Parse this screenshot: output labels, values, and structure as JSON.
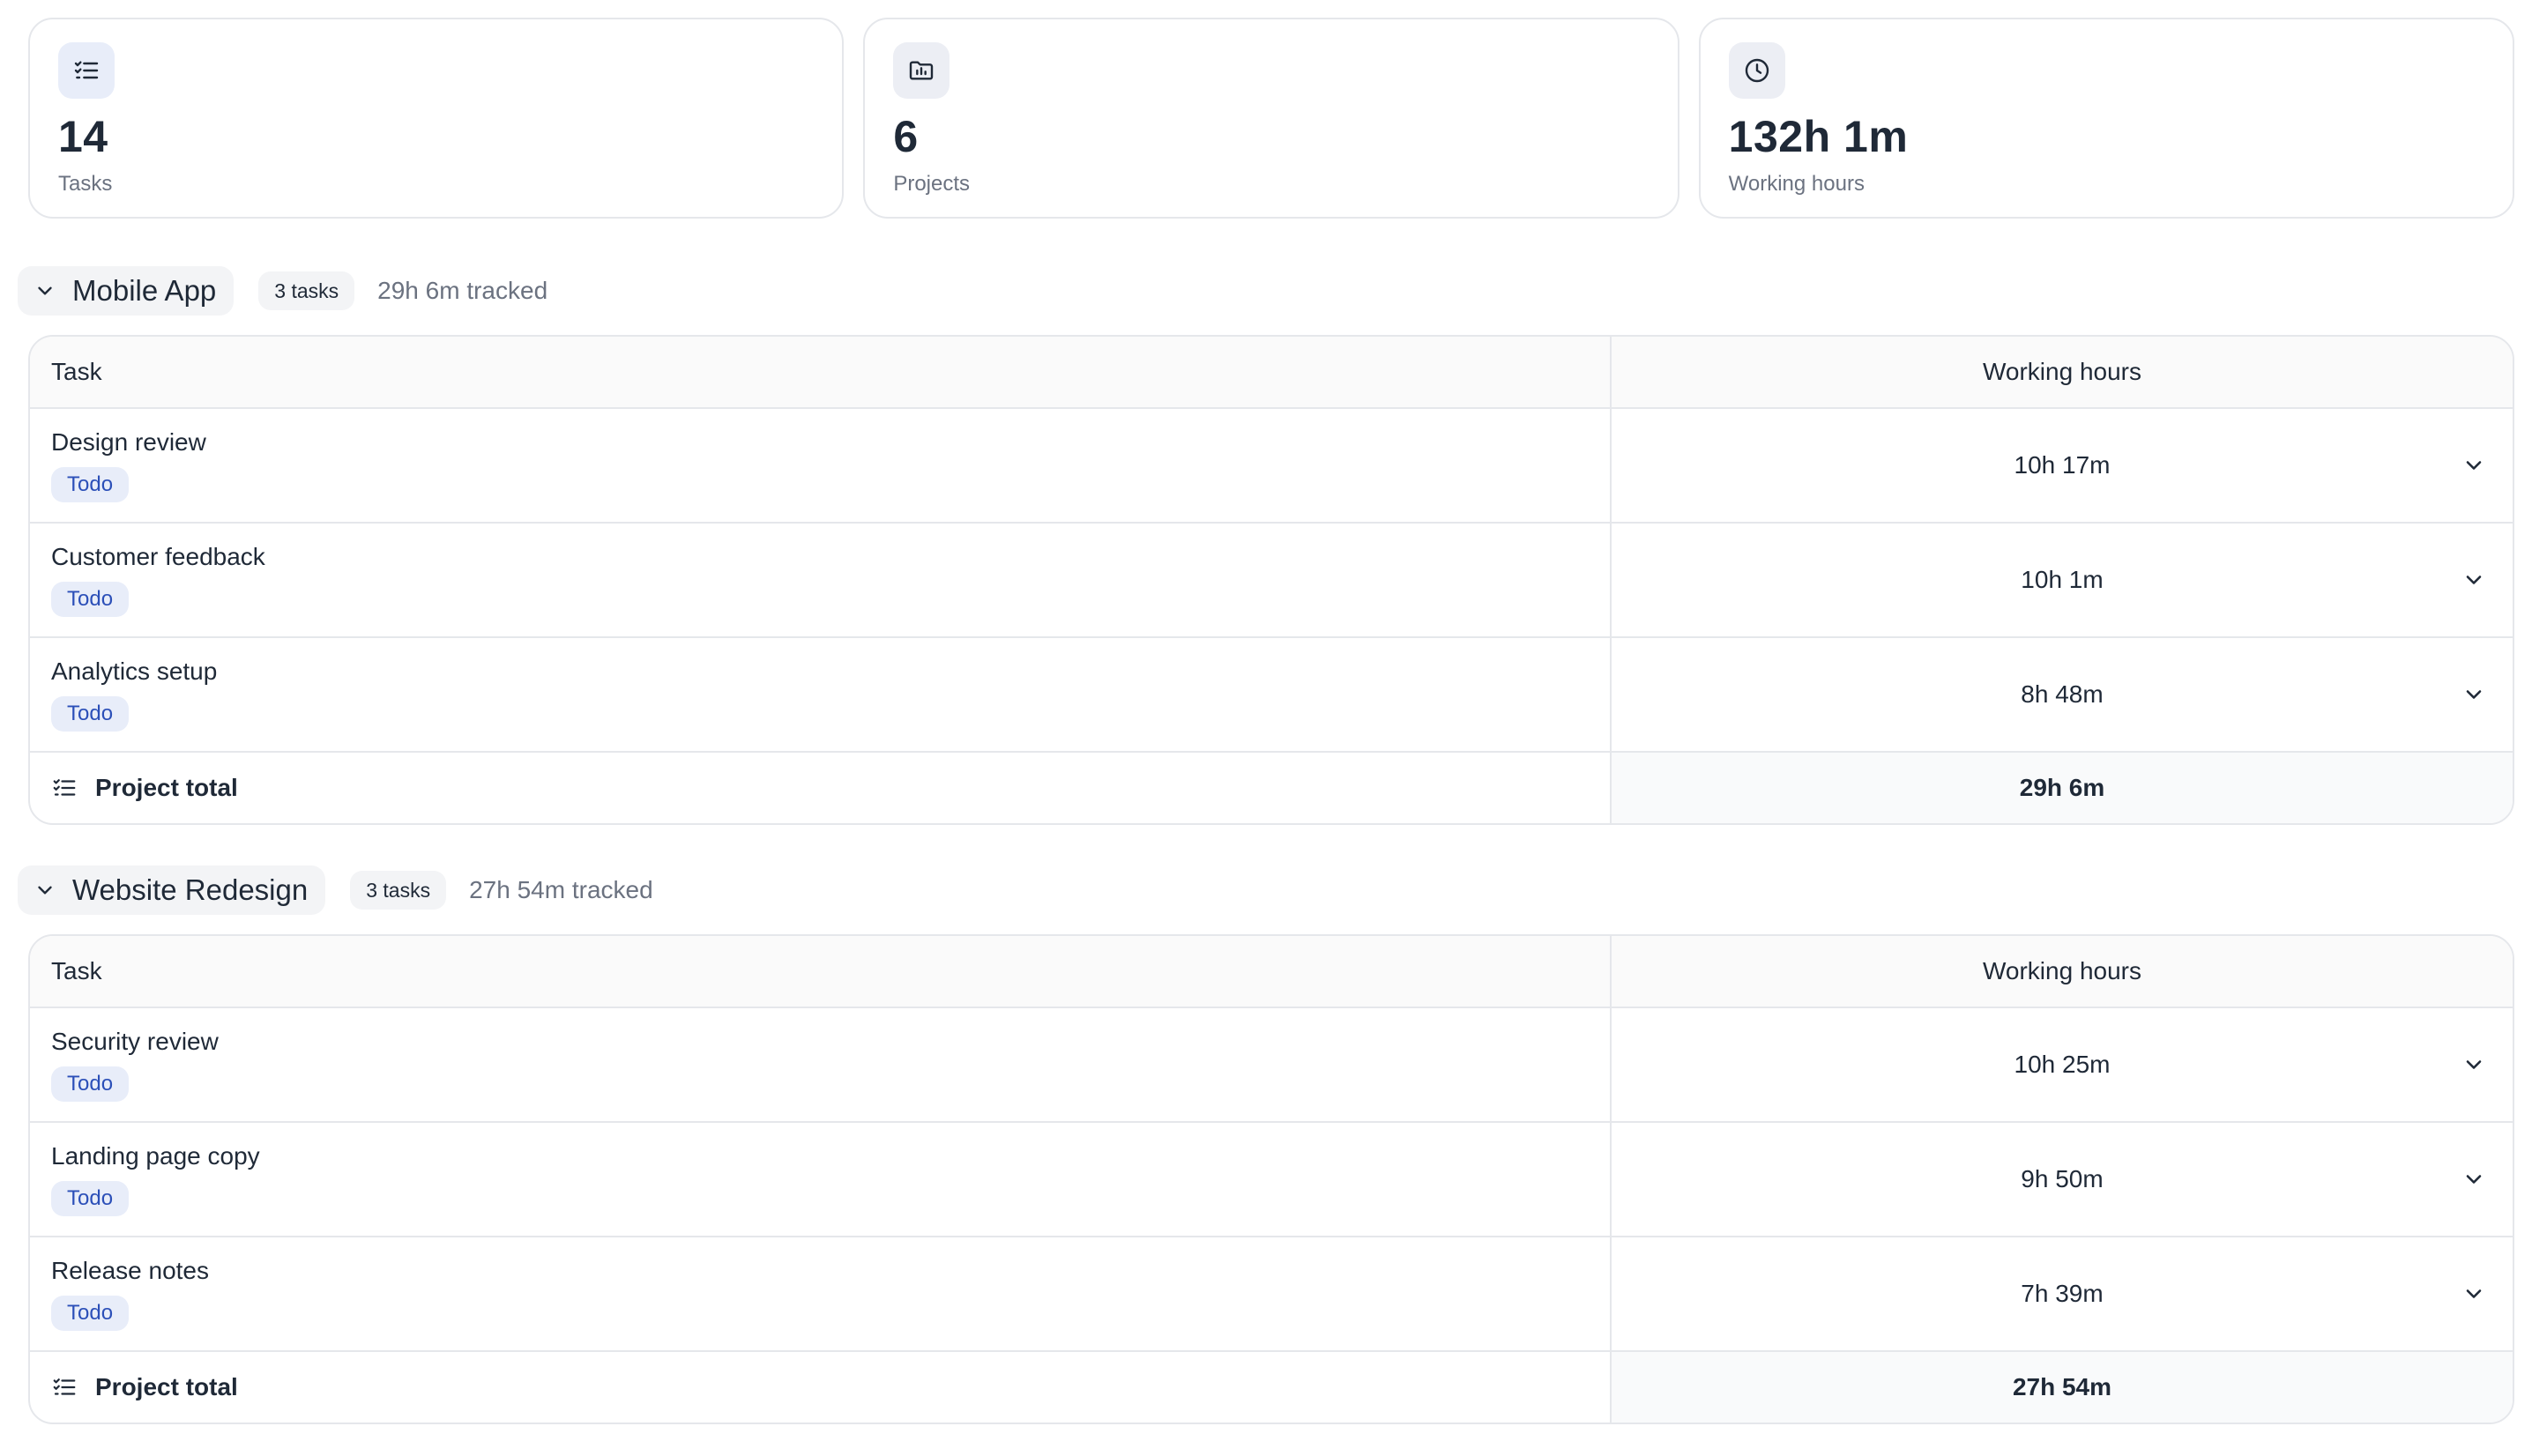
{
  "stats": [
    {
      "icon": "task-list-icon",
      "value": "14",
      "label": "Tasks"
    },
    {
      "icon": "folder-chart-icon",
      "value": "6",
      "label": "Projects"
    },
    {
      "icon": "clock-icon",
      "value": "132h 1m",
      "label": "Working hours"
    }
  ],
  "projects": [
    {
      "name": "Mobile App",
      "task_count": "3 tasks",
      "tracked": "29h 6m tracked",
      "columns": {
        "task": "Task",
        "hours": "Working hours"
      },
      "tasks": [
        {
          "name": "Design review",
          "status": "Todo",
          "hours": "10h 17m"
        },
        {
          "name": "Customer feedback",
          "status": "Todo",
          "hours": "10h 1m"
        },
        {
          "name": "Analytics setup",
          "status": "Todo",
          "hours": "8h 48m"
        }
      ],
      "total_label": "Project total",
      "total_value": "29h 6m"
    },
    {
      "name": "Website Redesign",
      "task_count": "3 tasks",
      "tracked": "27h 54m tracked",
      "columns": {
        "task": "Task",
        "hours": "Working hours"
      },
      "tasks": [
        {
          "name": "Security review",
          "status": "Todo",
          "hours": "10h 25m"
        },
        {
          "name": "Landing page copy",
          "status": "Todo",
          "hours": "9h 50m"
        },
        {
          "name": "Release notes",
          "status": "Todo",
          "hours": "7h 39m"
        }
      ],
      "total_label": "Project total",
      "total_value": "27h 54m"
    }
  ],
  "colors": {
    "badge_bg": "#e8edf9",
    "badge_text": "#2b4fb8",
    "border": "#e5e7eb",
    "muted_text": "#6b7280"
  }
}
